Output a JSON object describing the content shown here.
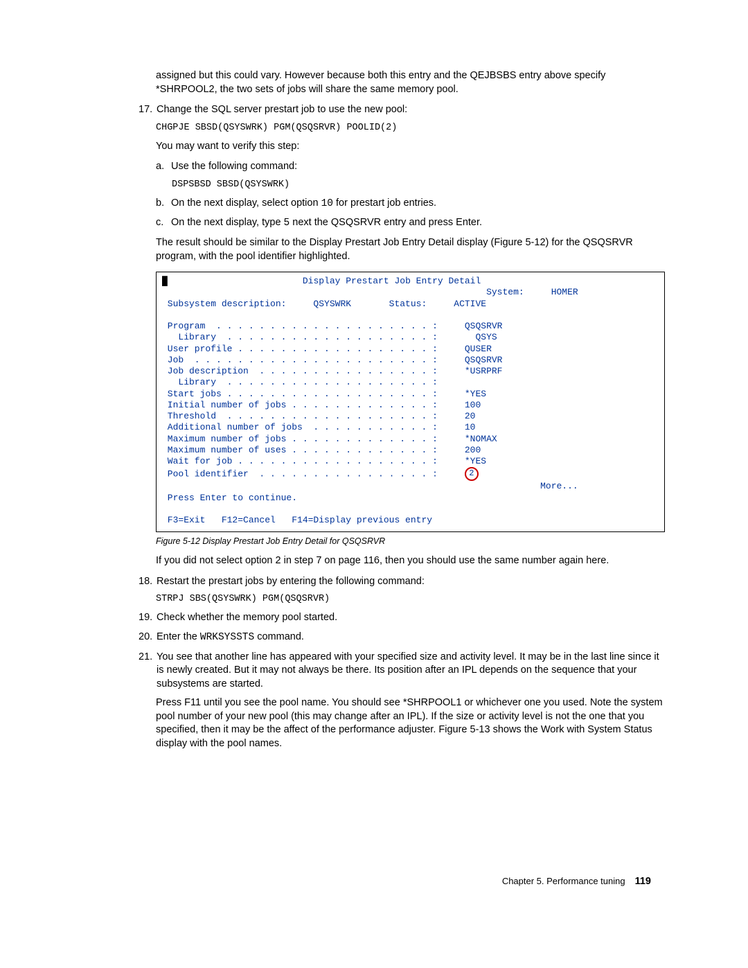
{
  "intro": "assigned but this could vary. However because both this entry and the QEJBSBS entry above specify *SHRPOOL2, the two sets of jobs will share the same memory pool.",
  "item17": {
    "num": "17.",
    "text": "Change the SQL server prestart job to use the new pool:",
    "cmd": "CHGPJE SBSD(QSYSWRK) PGM(QSQSRVR) POOLID(2)",
    "verify": "You may want to verify this step:",
    "a_label": "a.",
    "a_text": "Use the following command:",
    "a_cmd": "DSPSBSD SBSD(QSYSWRK)",
    "b_label": "b.",
    "b_text_pre": "On the next display, select option ",
    "b_opt": "10",
    "b_text_post": " for prestart job entries.",
    "c_label": "c.",
    "c_text_pre": "On the next display, type ",
    "c_opt": "5",
    "c_text_post": " next the QSQSRVR entry and press Enter.",
    "result": "The result should be similar to the Display Prestart Job Entry Detail display (Figure 5-12) for the QSQSRVR program, with the pool identifier highlighted."
  },
  "terminal": {
    "title": "Display Prestart Job Entry Detail",
    "system_lbl": "System:",
    "system_val": "HOMER",
    "subsys_lbl": "Subsystem description:",
    "subsys_val": "QSYSWRK",
    "status_lbl": "Status:",
    "status_val": "ACTIVE",
    "rows": [
      {
        "label": "Program  . . . . . . . . . . . . . . . . . . . . :",
        "val": "QSQSRVR"
      },
      {
        "label": "  Library  . . . . . . . . . . . . . . . . . . . :",
        "val": "  QSYS"
      },
      {
        "label": "User profile . . . . . . . . . . . . . . . . . . :",
        "val": "QUSER"
      },
      {
        "label": "Job  . . . . . . . . . . . . . . . . . . . . . . :",
        "val": "QSQSRVR"
      },
      {
        "label": "Job description  . . . . . . . . . . . . . . . . :",
        "val": "*USRPRF"
      },
      {
        "label": "  Library  . . . . . . . . . . . . . . . . . . . :",
        "val": ""
      },
      {
        "label": "Start jobs . . . . . . . . . . . . . . . . . . . :",
        "val": "*YES"
      },
      {
        "label": "Initial number of jobs . . . . . . . . . . . . . :",
        "val": "100"
      },
      {
        "label": "Threshold  . . . . . . . . . . . . . . . . . . . :",
        "val": "20"
      },
      {
        "label": "Additional number of jobs  . . . . . . . . . . . :",
        "val": "10"
      },
      {
        "label": "Maximum number of jobs . . . . . . . . . . . . . :",
        "val": "*NOMAX"
      },
      {
        "label": "Maximum number of uses . . . . . . . . . . . . . :",
        "val": "200"
      },
      {
        "label": "Wait for job . . . . . . . . . . . . . . . . . . :",
        "val": "*YES"
      },
      {
        "label": "Pool identifier  . . . . . . . . . . . . . . . . :",
        "val": "2",
        "circle": true
      }
    ],
    "more": "More...",
    "press_enter": "Press Enter to continue.",
    "fkeys": "F3=Exit   F12=Cancel   F14=Display previous entry"
  },
  "fig_caption": "Figure 5-12   Display Prestart Job Entry Detail for QSQSRVR",
  "after_fig": "If you did not select option 2 in step 7 on page 116, then you should use the same number again here.",
  "item18": {
    "num": "18.",
    "text": "Restart the prestart jobs by entering the following command:",
    "cmd": "STRPJ SBS(QSYSWRK) PGM(QSQSRVR)"
  },
  "item19": {
    "num": "19.",
    "text": "Check whether the memory pool started."
  },
  "item20": {
    "num": "20.",
    "text_pre": "Enter the ",
    "cmd_inline": "WRKSYSSTS",
    "text_post": " command."
  },
  "item21": {
    "num": "21.",
    "p1": "You see that another line has appeared with your specified size and activity level. It may be in the last line since it is newly created. But it may not always be there. Its position after an IPL depends on the sequence that your subsystems are started.",
    "p2": "Press F11 until you see the pool name. You should see *SHRPOOL1 or whichever one you used. Note the system pool number of your new pool (this may change after an IPL). If the size or activity level is not the one that you specified, then it may be the affect of the performance adjuster. Figure 5-13 shows the Work with System Status display with the pool names."
  },
  "footer": {
    "chapter": "Chapter 5. Performance tuning",
    "page": "119"
  }
}
